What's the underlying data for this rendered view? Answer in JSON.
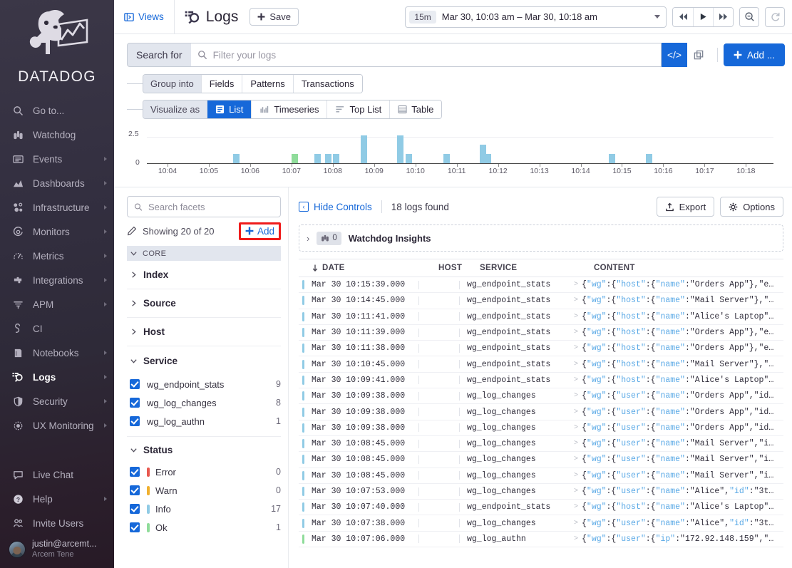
{
  "sidebar": {
    "brand": "DATADOG",
    "items": [
      {
        "label": "Go to...",
        "icon": "search-icon",
        "caret": false
      },
      {
        "label": "Watchdog",
        "icon": "binoculars-icon",
        "caret": false
      },
      {
        "label": "Events",
        "icon": "events-icon",
        "caret": true
      },
      {
        "label": "Dashboards",
        "icon": "dashboards-icon",
        "caret": true
      },
      {
        "label": "Infrastructure",
        "icon": "infrastructure-icon",
        "caret": true
      },
      {
        "label": "Monitors",
        "icon": "monitors-icon",
        "caret": true
      },
      {
        "label": "Metrics",
        "icon": "metrics-icon",
        "caret": true
      },
      {
        "label": "Integrations",
        "icon": "integrations-icon",
        "caret": true
      },
      {
        "label": "APM",
        "icon": "apm-icon",
        "caret": true
      },
      {
        "label": "CI",
        "icon": "ci-icon",
        "caret": false
      },
      {
        "label": "Notebooks",
        "icon": "notebooks-icon",
        "caret": true
      },
      {
        "label": "Logs",
        "icon": "logs-icon",
        "caret": true,
        "active": true
      },
      {
        "label": "Security",
        "icon": "shield-icon",
        "caret": true
      },
      {
        "label": "UX Monitoring",
        "icon": "ux-monitoring-icon",
        "caret": true
      }
    ],
    "bottom_items": [
      {
        "label": "Live Chat",
        "icon": "chat-icon",
        "caret": false
      },
      {
        "label": "Help",
        "icon": "help-icon",
        "caret": true
      },
      {
        "label": "Invite Users",
        "icon": "invite-users-icon",
        "caret": false
      }
    ],
    "user": {
      "email": "justin@arcemt...",
      "org": "Arcem Tene"
    }
  },
  "topbar": {
    "views_label": "Views",
    "page_title": "Logs",
    "save_label": "Save",
    "timerange_badge": "15m",
    "timerange_label": "Mar 30, 10:03 am – Mar 30, 10:18 am"
  },
  "search": {
    "label": "Search for",
    "placeholder": "Filter your logs",
    "value": "",
    "code_icon": "</>",
    "add_label": "Add ..."
  },
  "group_into": {
    "head": "Group into",
    "options": [
      "Fields",
      "Patterns",
      "Transactions"
    ],
    "selected": "Group into"
  },
  "visualize_as": {
    "head": "Visualize as",
    "options": [
      {
        "label": "List",
        "icon": "list-icon",
        "selected": true
      },
      {
        "label": "Timeseries",
        "icon": "timeseries-icon",
        "selected": false
      },
      {
        "label": "Top List",
        "icon": "toplist-icon",
        "selected": false
      },
      {
        "label": "Table",
        "icon": "table-icon",
        "selected": false
      }
    ]
  },
  "chart_data": {
    "type": "bar",
    "title": "",
    "xlabel": "",
    "ylabel": "",
    "ylim": [
      0,
      3.2
    ],
    "yticks": [
      0,
      2.5
    ],
    "ytick_labels": [
      "0",
      "2.5"
    ],
    "grid": true,
    "legend": null,
    "xtick_labels": [
      "10:04",
      "10:05",
      "10:06",
      "10:07",
      "10:08",
      "10:09",
      "10:10",
      "10:11",
      "10:12",
      "10:13",
      "10:14",
      "10:15",
      "10:16",
      "10:17",
      "10:18"
    ],
    "colors": {
      "info": "#90cbe5",
      "ok": "#8fdc9a"
    },
    "bars": [
      {
        "x": "10:05:40",
        "value": 1,
        "status": "info"
      },
      {
        "x": "10:07:05",
        "value": 1,
        "status": "ok"
      },
      {
        "x": "10:07:38",
        "value": 1,
        "status": "info"
      },
      {
        "x": "10:07:53",
        "value": 1,
        "status": "info"
      },
      {
        "x": "10:08:05",
        "value": 1,
        "status": "info"
      },
      {
        "x": "10:08:45",
        "value": 3,
        "status": "info"
      },
      {
        "x": "10:09:38",
        "value": 3,
        "status": "info"
      },
      {
        "x": "10:09:50",
        "value": 1,
        "status": "info"
      },
      {
        "x": "10:10:45",
        "value": 1,
        "status": "info"
      },
      {
        "x": "10:11:38",
        "value": 2,
        "status": "info"
      },
      {
        "x": "10:11:45",
        "value": 1,
        "status": "info"
      },
      {
        "x": "10:14:45",
        "value": 1,
        "status": "info"
      },
      {
        "x": "10:15:39",
        "value": 1,
        "status": "info"
      }
    ]
  },
  "facets": {
    "search_placeholder": "Search facets",
    "showing": "Showing 20 of 20",
    "add_label": "Add",
    "core_label": "CORE",
    "groups": [
      {
        "label": "Index",
        "open": false
      },
      {
        "label": "Source",
        "open": false
      },
      {
        "label": "Host",
        "open": false
      },
      {
        "label": "Service",
        "open": true
      }
    ],
    "service_values": [
      {
        "label": "wg_endpoint_stats",
        "count": "9",
        "checked": true
      },
      {
        "label": "wg_log_changes",
        "count": "8",
        "checked": true
      },
      {
        "label": "wg_log_authn",
        "count": "1",
        "checked": true
      }
    ],
    "status_label": "Status",
    "status_values": [
      {
        "label": "Error",
        "count": "0",
        "checked": true,
        "color": "#e8584f"
      },
      {
        "label": "Warn",
        "count": "0",
        "checked": true,
        "color": "#f0b02e"
      },
      {
        "label": "Info",
        "count": "17",
        "checked": true,
        "color": "#90cbe5"
      },
      {
        "label": "Ok",
        "count": "1",
        "checked": true,
        "color": "#8fdc9a"
      }
    ]
  },
  "logs": {
    "hide_controls": "Hide Controls",
    "count_label": "18 logs found",
    "export_label": "Export",
    "options_label": "Options",
    "watchdog_title": "Watchdog Insights",
    "watchdog_count": "0",
    "columns": [
      "DATE",
      "HOST",
      "SERVICE",
      "CONTENT"
    ],
    "rows": [
      {
        "date": "Mar 30 10:15:39.000",
        "host": "",
        "service": "wg_endpoint_stats",
        "content": "{\"wg\":{\"host\":{\"name\":\"Orders App\"},\"e…",
        "status": "info"
      },
      {
        "date": "Mar 30 10:14:45.000",
        "host": "",
        "service": "wg_endpoint_stats",
        "content": "{\"wg\":{\"host\":{\"name\":\"Mail Server\"},\"…",
        "status": "info"
      },
      {
        "date": "Mar 30 10:11:41.000",
        "host": "",
        "service": "wg_endpoint_stats",
        "content": "{\"wg\":{\"host\":{\"name\":\"Alice's Laptop\"…",
        "status": "info"
      },
      {
        "date": "Mar 30 10:11:39.000",
        "host": "",
        "service": "wg_endpoint_stats",
        "content": "{\"wg\":{\"host\":{\"name\":\"Orders App\"},\"e…",
        "status": "info"
      },
      {
        "date": "Mar 30 10:11:38.000",
        "host": "",
        "service": "wg_endpoint_stats",
        "content": "{\"wg\":{\"host\":{\"name\":\"Orders App\"},\"e…",
        "status": "info"
      },
      {
        "date": "Mar 30 10:10:45.000",
        "host": "",
        "service": "wg_endpoint_stats",
        "content": "{\"wg\":{\"host\":{\"name\":\"Mail Server\"},\"…",
        "status": "info"
      },
      {
        "date": "Mar 30 10:09:41.000",
        "host": "",
        "service": "wg_endpoint_stats",
        "content": "{\"wg\":{\"host\":{\"name\":\"Alice's Laptop\"…",
        "status": "info"
      },
      {
        "date": "Mar 30 10:09:38.000",
        "host": "",
        "service": "wg_log_changes",
        "content": "{\"wg\":{\"user\":{\"name\":\"Orders App\",\"id…",
        "status": "info"
      },
      {
        "date": "Mar 30 10:09:38.000",
        "host": "",
        "service": "wg_log_changes",
        "content": "{\"wg\":{\"user\":{\"name\":\"Orders App\",\"id…",
        "status": "info"
      },
      {
        "date": "Mar 30 10:09:38.000",
        "host": "",
        "service": "wg_log_changes",
        "content": "{\"wg\":{\"user\":{\"name\":\"Orders App\",\"id…",
        "status": "info"
      },
      {
        "date": "Mar 30 10:08:45.000",
        "host": "",
        "service": "wg_log_changes",
        "content": "{\"wg\":{\"user\":{\"name\":\"Mail Server\",\"i…",
        "status": "info"
      },
      {
        "date": "Mar 30 10:08:45.000",
        "host": "",
        "service": "wg_log_changes",
        "content": "{\"wg\":{\"user\":{\"name\":\"Mail Server\",\"i…",
        "status": "info"
      },
      {
        "date": "Mar 30 10:08:45.000",
        "host": "",
        "service": "wg_log_changes",
        "content": "{\"wg\":{\"user\":{\"name\":\"Mail Server\",\"i…",
        "status": "info"
      },
      {
        "date": "Mar 30 10:07:53.000",
        "host": "",
        "service": "wg_log_changes",
        "content": "{\"wg\":{\"user\":{\"name\":\"Alice\",\"id\":\"3t…",
        "status": "info"
      },
      {
        "date": "Mar 30 10:07:40.000",
        "host": "",
        "service": "wg_endpoint_stats",
        "content": "{\"wg\":{\"host\":{\"name\":\"Alice's Laptop\"…",
        "status": "info"
      },
      {
        "date": "Mar 30 10:07:38.000",
        "host": "",
        "service": "wg_log_changes",
        "content": "{\"wg\":{\"user\":{\"name\":\"Alice\",\"id\":\"3t…",
        "status": "info"
      },
      {
        "date": "Mar 30 10:07:06.000",
        "host": "",
        "service": "wg_log_authn",
        "content": "{\"wg\":{\"user\":{\"ip\":\"172.92.148.159\",\"…",
        "status": "ok"
      }
    ]
  },
  "colors": {
    "accent_blue": "#1668d9",
    "highlight_red": "#ef1b1b",
    "info": "#90cbe5",
    "ok": "#8fdc9a"
  }
}
